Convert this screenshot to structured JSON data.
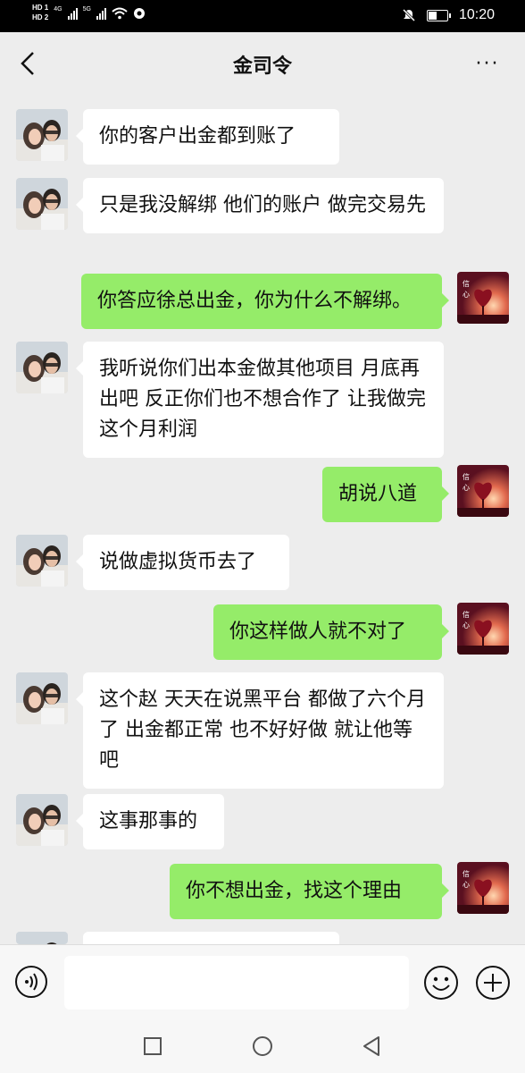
{
  "status_bar": {
    "network_top": "HD 1",
    "network_bottom": "HD 2",
    "signal_1": "4G",
    "signal_2": "5G",
    "time": "10:20",
    "icons": [
      "mute-icon",
      "battery-icon"
    ],
    "battery_level": 0.5
  },
  "header": {
    "title": "金司令",
    "back_icon": "chevron-left-icon",
    "more_label": "···"
  },
  "messages": [
    {
      "side": "left",
      "text": "你的客户出金都到账了"
    },
    {
      "side": "left",
      "text": "只是我没解绑 他们的账户 做完交易先"
    },
    {
      "side": "right",
      "text": "你答应徐总出金，你为什么不解绑。"
    },
    {
      "side": "left",
      "text": "我听说你们出本金做其他项目 月底再出吧 反正你们也不想合作了 让我做完这个月利润"
    },
    {
      "side": "right",
      "text": "胡说八道"
    },
    {
      "side": "left",
      "text": "说做虚拟货币去了"
    },
    {
      "side": "right",
      "text": "你这样做人就不对了"
    },
    {
      "side": "left",
      "text": "这个赵 天天在说黑平台 都做了六个月了 出金都正常 也不好好做 就让他等吧"
    },
    {
      "side": "left",
      "text": "这事那事的"
    },
    {
      "side": "right",
      "text": "你不想出金，找这个理由"
    }
  ],
  "input_bar": {
    "placeholder": "",
    "voice_icon": "voice-icon",
    "emoji_icon": "emoji-icon",
    "plus_icon": "plus-icon"
  },
  "nav_bar": {
    "icons": [
      "recent-apps-icon",
      "home-icon",
      "back-icon"
    ]
  },
  "colors": {
    "background": "#ededed",
    "bubble_self": "#95ec69",
    "bubble_other": "#ffffff"
  }
}
